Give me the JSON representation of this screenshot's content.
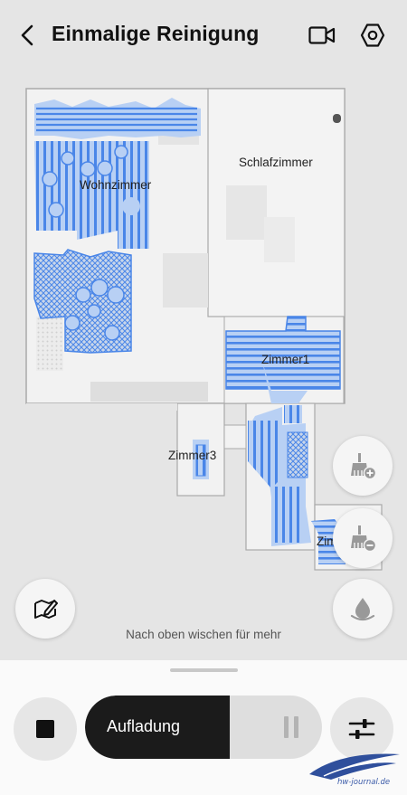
{
  "header": {
    "title": "Einmalige Reinigung",
    "back_icon": "chevron-left-icon",
    "video_icon": "video-camera-icon",
    "settings_icon": "hexagon-settings-icon"
  },
  "map": {
    "rooms": {
      "wohnzimmer": "Wohnzimmer",
      "schlafzimmer": "Schlafzimmer",
      "zimmer1": "Zimmer1",
      "zimmer3": "Zimmer3",
      "zimmer_partial": "Zim"
    },
    "colors": {
      "cleaned": "#4a86e8",
      "cleaned_fill": "#b8d0f4",
      "floor": "#f0f0f0",
      "wall": "#a9a9a9"
    }
  },
  "controls": {
    "add_cleaning_icon": "broom-plus-icon",
    "remove_cleaning_icon": "broom-minus-icon",
    "water_icon": "water-drop-icon",
    "edit_map_icon": "map-edit-icon"
  },
  "hint": "Nach oben wischen für mehr",
  "bottom": {
    "status_label": "Aufladung",
    "stop_icon": "stop-icon",
    "pause_icon": "pause-icon",
    "options_icon": "sliders-icon"
  },
  "watermark": {
    "text": "hw-journal.de"
  }
}
